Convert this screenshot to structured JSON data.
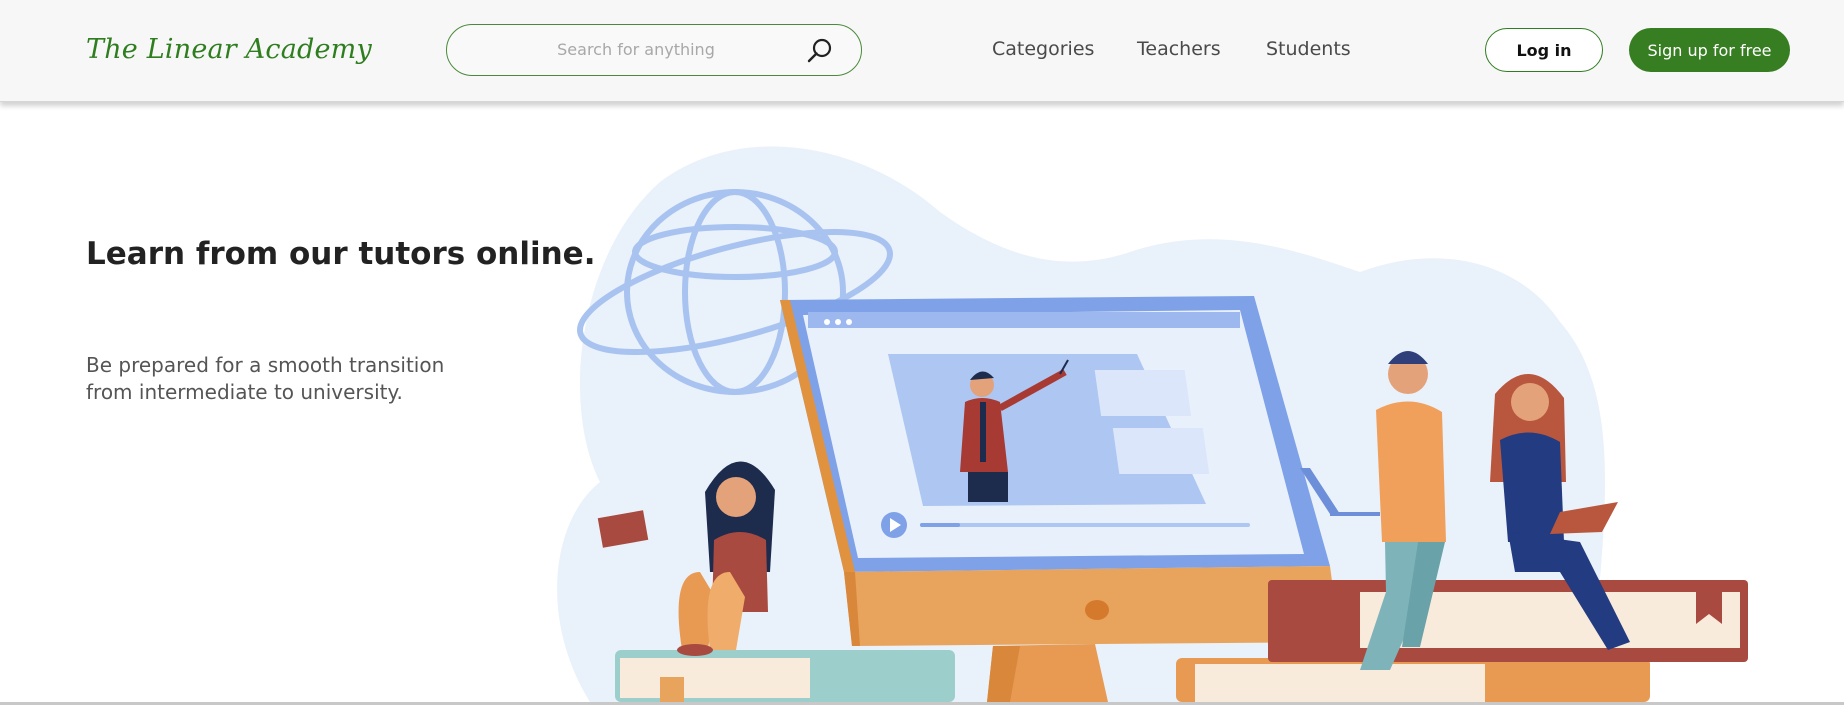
{
  "header": {
    "logo": "The Linear Academy",
    "search": {
      "placeholder": "Search for anything",
      "value": "",
      "icon": "search-icon"
    },
    "nav": {
      "categories": "Categories",
      "teachers": "Teachers",
      "students": "Students"
    },
    "login_label": "Log in",
    "signup_label": "Sign up for free"
  },
  "hero": {
    "title": "Learn from our tutors online.",
    "subtitle_line1": "Be prepared for a smooth transition",
    "subtitle_line2": "from intermediate to university."
  },
  "colors": {
    "brand_green": "#377d22",
    "logo_green": "#2e7d1f",
    "header_bg": "#f7f7f7",
    "blob_bg": "#e9f1fa",
    "screen_blue": "#7ea1e8",
    "orange": "#e89a52",
    "book_red": "#a84a3f",
    "book_teal": "#9ccfcc"
  }
}
